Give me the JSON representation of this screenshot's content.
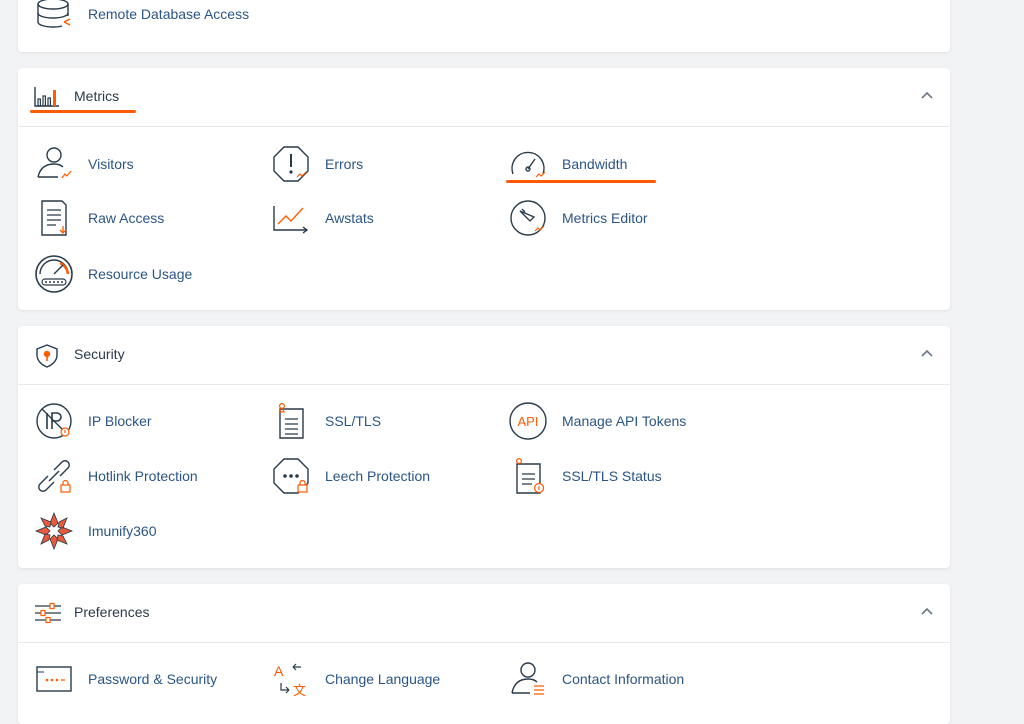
{
  "top_partial": {
    "items": [
      {
        "label": "Remote Database Access",
        "icon": "remote-database-icon"
      }
    ]
  },
  "metrics": {
    "title": "Metrics",
    "items": [
      {
        "label": "Visitors",
        "icon": "visitors-icon"
      },
      {
        "label": "Errors",
        "icon": "errors-icon"
      },
      {
        "label": "Bandwidth",
        "icon": "bandwidth-icon"
      },
      {
        "label": "Raw Access",
        "icon": "raw-access-icon"
      },
      {
        "label": "Awstats",
        "icon": "awstats-icon"
      },
      {
        "label": "Metrics Editor",
        "icon": "metrics-editor-icon"
      },
      {
        "label": "Resource Usage",
        "icon": "resource-usage-icon"
      }
    ]
  },
  "security": {
    "title": "Security",
    "items": [
      {
        "label": "IP Blocker",
        "icon": "ip-blocker-icon"
      },
      {
        "label": "SSL/TLS",
        "icon": "ssl-tls-icon"
      },
      {
        "label": "Manage API Tokens",
        "icon": "api-tokens-icon"
      },
      {
        "label": "Hotlink Protection",
        "icon": "hotlink-protection-icon"
      },
      {
        "label": "Leech Protection",
        "icon": "leech-protection-icon"
      },
      {
        "label": "SSL/TLS Status",
        "icon": "ssl-tls-status-icon"
      },
      {
        "label": "Imunify360",
        "icon": "imunify360-icon"
      }
    ]
  },
  "preferences": {
    "title": "Preferences",
    "items": [
      {
        "label": "Password & Security",
        "icon": "password-security-icon"
      },
      {
        "label": "Change Language",
        "icon": "change-language-icon"
      },
      {
        "label": "Contact Information",
        "icon": "contact-information-icon"
      }
    ]
  },
  "colors": {
    "accent": "#ff5b00",
    "link": "#2b5585",
    "icon_stroke": "#293a4a"
  }
}
